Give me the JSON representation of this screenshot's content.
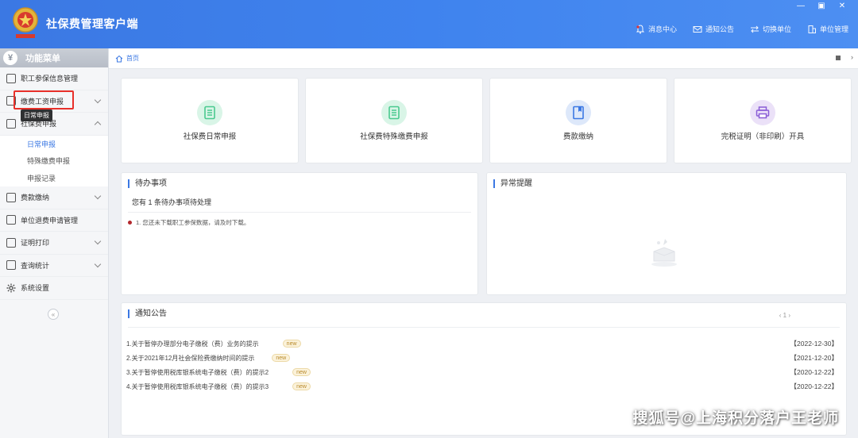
{
  "header": {
    "title": "社保费管理客户端",
    "nav": [
      {
        "icon": "bell-icon",
        "label": "消息中心"
      },
      {
        "icon": "mail-icon",
        "label": "通知公告"
      },
      {
        "icon": "switch-icon",
        "label": "切换单位"
      },
      {
        "icon": "building-icon",
        "label": "单位管理"
      }
    ],
    "window_controls": [
      "—",
      "▣",
      "✕"
    ]
  },
  "sidebar": {
    "title": "功能菜单",
    "items": [
      {
        "label": "职工参保信息管理",
        "icon": "id-card-icon",
        "has_arrow": false
      },
      {
        "label": "缴费工资申报",
        "icon": "edit-icon",
        "has_arrow": true
      },
      {
        "label": "社保费申报",
        "icon": "form-icon",
        "has_arrow": true,
        "expanded": true
      },
      {
        "label": "费款缴纳",
        "icon": "wallet-icon",
        "has_arrow": true
      },
      {
        "label": "单位退费申请管理",
        "icon": "refund-icon",
        "has_arrow": false
      },
      {
        "label": "证明打印",
        "icon": "print-icon",
        "has_arrow": true
      },
      {
        "label": "查询统计",
        "icon": "chart-icon",
        "has_arrow": true
      },
      {
        "label": "系统设置",
        "icon": "gear-icon",
        "has_arrow": false
      }
    ],
    "subitems": [
      {
        "label": "日常申报",
        "active": true
      },
      {
        "label": "特殊缴费申报"
      },
      {
        "label": "申报记录"
      }
    ],
    "tooltip": "日常申报",
    "collapse": "«"
  },
  "tabbar": {
    "home_label": "首页"
  },
  "cards": [
    {
      "label": "社保费日常申报",
      "icon": "document-icon",
      "color": "#49c98f",
      "bg": "#d9f5e7"
    },
    {
      "label": "社保费特殊缴费申报",
      "icon": "document-icon",
      "color": "#49c98f",
      "bg": "#d9f5e7"
    },
    {
      "label": "费款缴纳",
      "icon": "book-icon",
      "color": "#3b78e3",
      "bg": "#dde8fa"
    },
    {
      "label": "完税证明（非印刷）开具",
      "icon": "printer-icon",
      "color": "#8a5cd6",
      "bg": "#ebe1f8"
    }
  ],
  "todo": {
    "title": "待办事项",
    "summary": "您有 1 条待办事项待处理",
    "items": [
      "1. 您还未下载职工参保数据，请及时下载。"
    ]
  },
  "alerts": {
    "title": "异常提醒"
  },
  "notices": {
    "title": "通知公告",
    "pager": "‹ 1 ›",
    "new_badge": "new",
    "rows": [
      {
        "text": "1.关于暂停办理部分电子缴税（费）业务的提示",
        "date": "【2022-12-30】"
      },
      {
        "text": "2.关于2021年12月社会保险费缴纳时间的提示",
        "date": "【2021-12-20】"
      },
      {
        "text": "3.关于暂停使用税库银系统电子缴税（费）的提示2",
        "date": "【2020-12-22】"
      },
      {
        "text": "4.关于暂停使用税库银系统电子缴税（费）的提示3",
        "date": "【2020-12-22】"
      }
    ]
  },
  "watermark": "搜狐号@上海积分落户王老师",
  "colors": {
    "accent": "#3b78e3",
    "highlight": "#e8302a"
  }
}
